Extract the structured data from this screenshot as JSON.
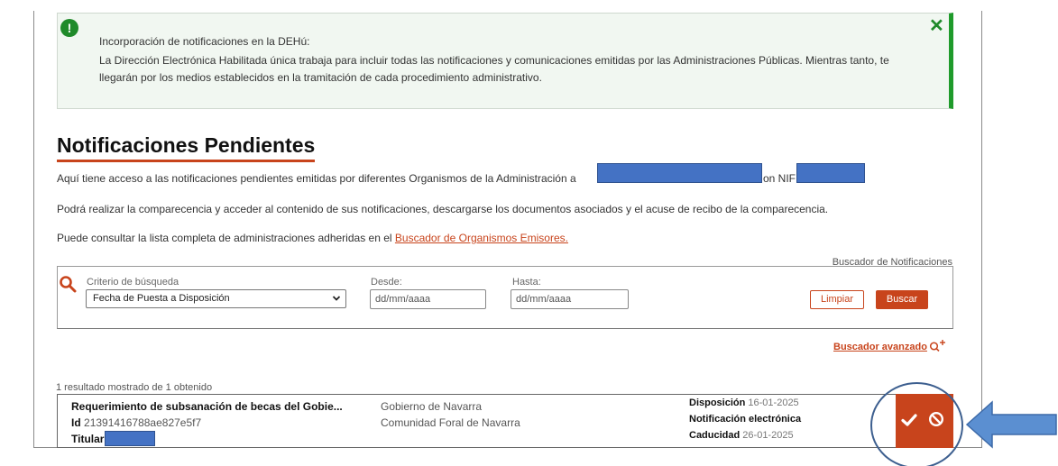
{
  "alert": {
    "title": "Incorporación de notificaciones en la DEHú:",
    "body": "La Dirección Electrónica Habilitada única trabaja para incluir todas las notificaciones y comunicaciones emitidas por las Administraciones Públicas. Mientras tanto, te llegarán por los medios establecidos en la tramitación de cada procedimiento administrativo.",
    "close": "✕"
  },
  "page": {
    "title": "Notificaciones Pendientes",
    "intro_prefix": "Aquí tiene acceso a las notificaciones pendientes emitidas por diferentes Organismos de la Administración a",
    "intro_nif": "on NIF",
    "line2": "Podrá realizar la comparecencia y acceder al contenido de sus notificaciones, descargarse los documentos asociados y el acuse de recibo de la comparecencia.",
    "line3_prefix": "Puede consultar la lista completa de administraciones adheridas en el",
    "line3_link": "Buscador de Organismos Emisores."
  },
  "search": {
    "section_label": "Buscador de Notificaciones",
    "criteria_label": "Criterio de búsqueda",
    "criteria_value": "Fecha de Puesta a Disposición",
    "from_label": "Desde:",
    "from_placeholder": "dd/mm/aaaa",
    "to_label": "Hasta:",
    "to_placeholder": "dd/mm/aaaa",
    "clear_label": "Limpiar",
    "search_label": "Buscar",
    "advanced_label": "Buscador avanzado"
  },
  "results": {
    "count_text": "1 resultado mostrado de 1 obtenido",
    "items": [
      {
        "title": "Requerimiento de subsanación de becas del Gobie...",
        "id_label": "Id",
        "id_value": "21391416788ae827e5f7",
        "owner_label": "Titular",
        "organism": "Gobierno de Navarra",
        "organism_sub": "Comunidad Foral de Navarra",
        "disposition_label": "Disposición",
        "disposition_date": "16-01-2025",
        "type": "Notificación electrónica",
        "expiry_label": "Caducidad",
        "expiry_date": "26-01-2025"
      }
    ]
  },
  "colors": {
    "accent": "#c8441c",
    "alert_green": "#1f8a2a",
    "redaction": "#4472c4"
  },
  "icons": [
    "alert-icon",
    "close-icon",
    "search-icon",
    "chevron-down-icon",
    "advanced-search-icon",
    "accept-check-icon",
    "reject-ban-icon",
    "callout-arrow"
  ]
}
